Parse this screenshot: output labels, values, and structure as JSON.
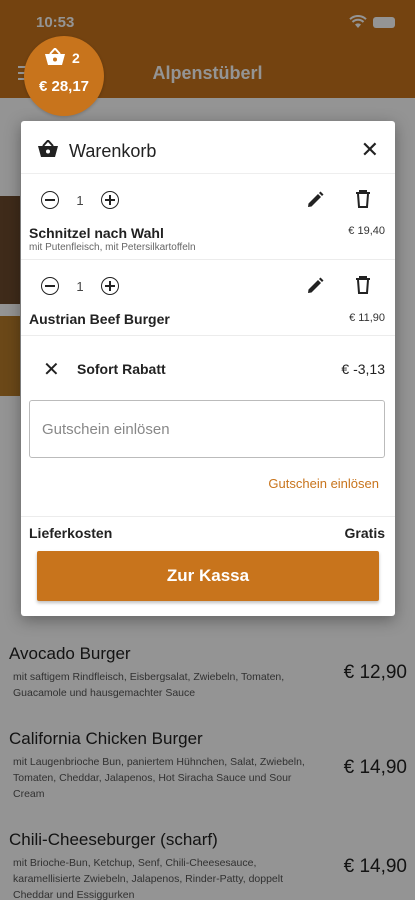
{
  "status": {
    "time": "10:53"
  },
  "header": {
    "title": "Alpenstüberl"
  },
  "cart_bubble": {
    "count": "2",
    "total": "€ 28,17"
  },
  "cart": {
    "title": "Warenkorb",
    "items": [
      {
        "qty": "1",
        "name": "Schnitzel nach Wahl",
        "options": "mit Putenfleisch, mit Petersilkartoffeln",
        "price": "€ 19,40"
      },
      {
        "qty": "1",
        "name": "Austrian Beef Burger",
        "options": "",
        "price": "€ 11,90"
      }
    ],
    "discount": {
      "label": "Sofort Rabatt",
      "value": "€ -3,13"
    },
    "voucher": {
      "placeholder": "Gutschein einlösen",
      "link": "Gutschein einlösen"
    },
    "delivery": {
      "label": "Lieferkosten",
      "value": "Gratis"
    },
    "checkout_label": "Zur Kassa"
  },
  "menu": {
    "items": [
      {
        "name": "Avocado Burger",
        "desc": "mit saftigem Rindfleisch, Eisbergsalat, Zwiebeln, Tomaten, Guacamole und hausgemachter Sauce",
        "price": "€ 12,90"
      },
      {
        "name": "California Chicken Burger",
        "desc": "mit Laugenbrioche Bun, paniertem Hühnchen, Salat, Zwiebeln, Tomaten, Cheddar, Jalapenos, Hot Siracha Sauce und Sour Cream",
        "price": "€ 14,90"
      },
      {
        "name": "Chili-Cheeseburger (scharf)",
        "desc": "mit Brioche-Bun, Ketchup, Senf, Chili-Cheesesauce, karamellisierte Zwiebeln, Jalapenos, Rinder-Patty, doppelt Cheddar und Essiggurken",
        "price": "€ 14,90"
      }
    ]
  }
}
